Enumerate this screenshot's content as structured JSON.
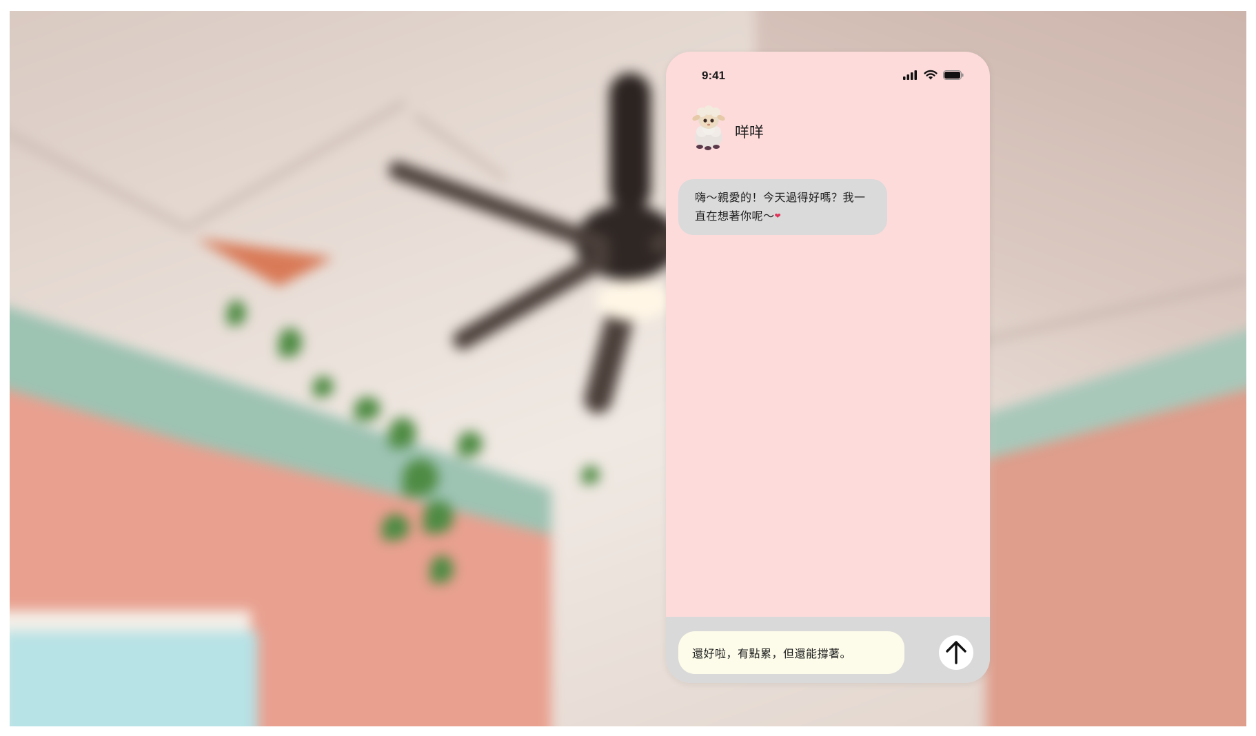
{
  "status_bar": {
    "time": "9:41",
    "icons": [
      "cellular-signal-icon",
      "wifi-icon",
      "battery-icon"
    ]
  },
  "chat": {
    "contact_name": "咩咩",
    "avatar": "sheep-avatar"
  },
  "messages": [
    {
      "direction": "incoming",
      "text": "嗨～親愛的！今天過得好嗎？我一直在想著你呢～",
      "emoji": "heart-icon"
    }
  ],
  "composer": {
    "value": "還好啦，有點累，但還能撐著。",
    "send_icon": "arrow-up-icon"
  },
  "colors": {
    "phone_background": "#fddbdb",
    "incoming_bubble": "#dadada",
    "input_bar": "#d9d9d9",
    "input_field": "#fdfcea",
    "send_button": "#ffffff",
    "heart": "#e0335a"
  }
}
